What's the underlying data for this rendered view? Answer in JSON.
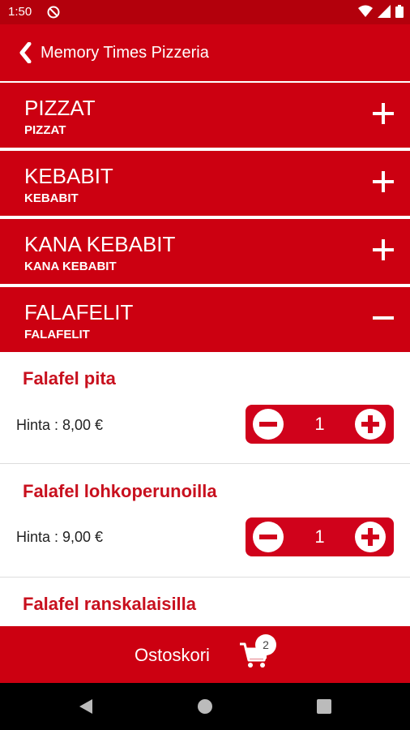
{
  "status_bar": {
    "time": "1:50",
    "icons": [
      "do-not-disturb-icon",
      "wifi-icon",
      "signal-icon",
      "battery-icon"
    ]
  },
  "app_bar": {
    "title": "Memory Times Pizzeria",
    "back_icon": "chevron-left-icon"
  },
  "categories": [
    {
      "title": "PIZZAT",
      "subtitle": "PIZZAT",
      "expanded": false
    },
    {
      "title": "KEBABIT",
      "subtitle": "KEBABIT",
      "expanded": false
    },
    {
      "title": "KANA KEBABIT",
      "subtitle": "KANA KEBABIT",
      "expanded": false
    },
    {
      "title": "FALAFELIT",
      "subtitle": "FALAFELIT",
      "expanded": true
    }
  ],
  "items": [
    {
      "name": "Falafel pita",
      "price_label": "Hinta : 8,00 €",
      "quantity": "1"
    },
    {
      "name": "Falafel lohkoperunoilla",
      "price_label": "Hinta : 9,00 €",
      "quantity": "1"
    },
    {
      "name": "Falafel ranskalaisilla"
    }
  ],
  "cart": {
    "label": "Ostoskori",
    "count": "2"
  },
  "colors": {
    "primary": "#cc0011",
    "status_bar": "#b3000c",
    "item_title": "#c8101e",
    "stepper": "#d0021b"
  }
}
